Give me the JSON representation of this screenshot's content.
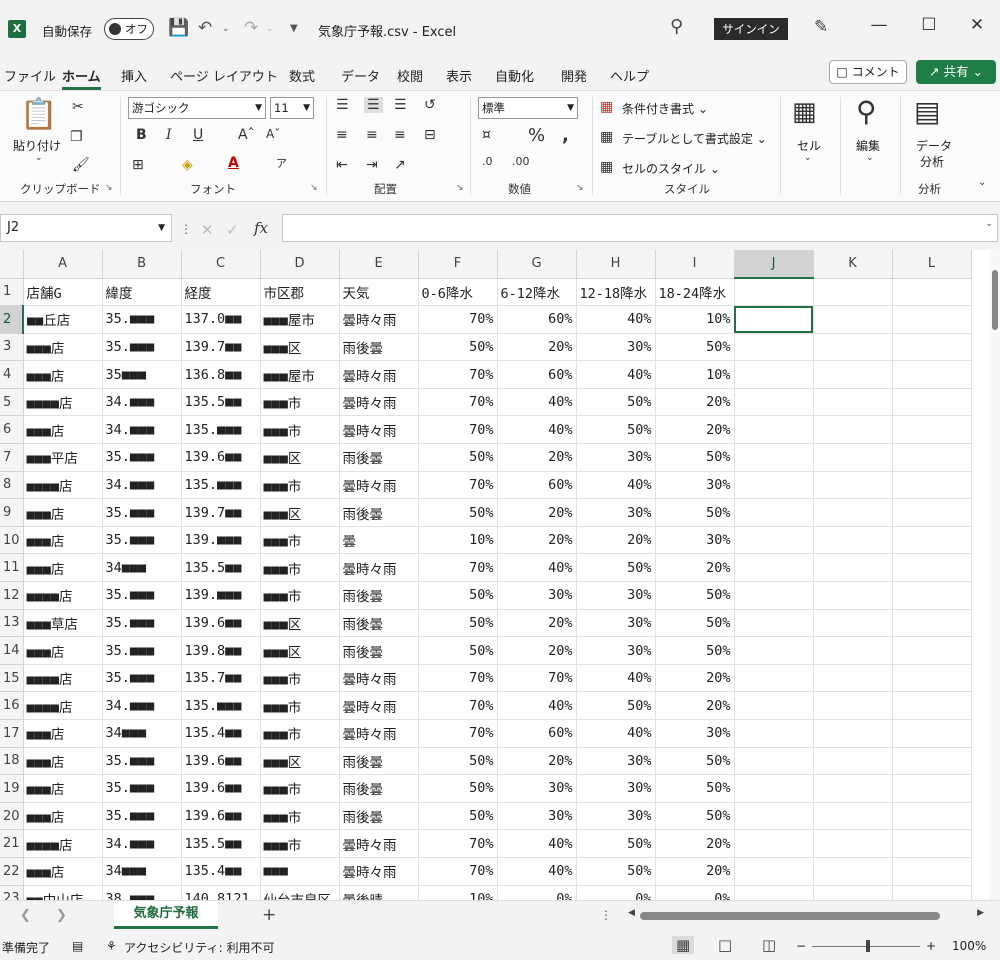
{
  "titlebar": {
    "logo": "X",
    "autosave_label": "自動保存",
    "toggle_label": "オフ",
    "doc_title": "気象庁予報.csv  -  Excel",
    "signin_label": "サインイン"
  },
  "menu": {
    "tabs": [
      "ファイル",
      "ホーム",
      "挿入",
      "ページ レイアウト",
      "数式",
      "データ",
      "校閲",
      "表示",
      "自動化",
      "開発",
      "ヘルプ"
    ],
    "active_tab": "ホーム",
    "comment_label": "コメント",
    "share_label": "共有"
  },
  "ribbon": {
    "clipboard": {
      "paste_label": "貼り付け",
      "group_label": "クリップボード"
    },
    "font": {
      "font_name": "游ゴシック",
      "font_size": "11",
      "group_label": "フォント"
    },
    "alignment": {
      "group_label": "配置"
    },
    "number": {
      "format": "標準",
      "group_label": "数値"
    },
    "styles": {
      "conditional_label": "条件付き書式",
      "table_label": "テーブルとして書式設定",
      "cell_style_label": "セルのスタイル",
      "group_label": "スタイル"
    },
    "cells": {
      "label": "セル"
    },
    "editing": {
      "label": "編集"
    },
    "analysis": {
      "button_label_1": "データ",
      "button_label_2": "分析",
      "group_label": "分析"
    }
  },
  "formula_bar": {
    "name_box": "J2",
    "fx": "fx",
    "value": ""
  },
  "grid": {
    "columns": [
      "A",
      "B",
      "C",
      "D",
      "E",
      "F",
      "G",
      "H",
      "I",
      "J",
      "K",
      "L"
    ],
    "selected_cell": "J2",
    "rows": [
      [
        "店舗G",
        "緯度",
        "経度",
        "市区郡",
        "天気",
        "0-6降水",
        "6-12降水",
        "12-18降水",
        "18-24降水"
      ],
      [
        "■■丘店",
        "35.■■■",
        "137.0■■",
        "■■■屋市",
        "曇時々雨",
        "70%",
        "60%",
        "40%",
        "10%"
      ],
      [
        "■■■店",
        "35.■■■",
        "139.7■■",
        "■■■区",
        "雨後曇",
        "50%",
        "20%",
        "30%",
        "50%"
      ],
      [
        "■■■店",
        "35■■■",
        "136.8■■",
        "■■■屋市",
        "曇時々雨",
        "70%",
        "60%",
        "40%",
        "10%"
      ],
      [
        "■■■■店",
        "34.■■■",
        "135.5■■",
        "■■■市",
        "曇時々雨",
        "70%",
        "40%",
        "50%",
        "20%"
      ],
      [
        "■■■店",
        "34.■■■",
        "135.■■■",
        "■■■市",
        "曇時々雨",
        "70%",
        "40%",
        "50%",
        "20%"
      ],
      [
        "■■■平店",
        "35.■■■",
        "139.6■■",
        "■■■区",
        "雨後曇",
        "50%",
        "20%",
        "30%",
        "50%"
      ],
      [
        "■■■■店",
        "34.■■■",
        "135.■■■",
        "■■■市",
        "曇時々雨",
        "70%",
        "60%",
        "40%",
        "30%"
      ],
      [
        "■■■店",
        "35.■■■",
        "139.7■■",
        "■■■区",
        "雨後曇",
        "50%",
        "20%",
        "30%",
        "50%"
      ],
      [
        "■■■店",
        "35.■■■",
        "139.■■■",
        "■■■市",
        "曇",
        "10%",
        "20%",
        "20%",
        "30%"
      ],
      [
        "■■■店",
        "34■■■",
        "135.5■■",
        "■■■市",
        "曇時々雨",
        "70%",
        "40%",
        "50%",
        "20%"
      ],
      [
        "■■■■店",
        "35.■■■",
        "139.■■■",
        "■■■市",
        "雨後曇",
        "50%",
        "30%",
        "30%",
        "50%"
      ],
      [
        "■■■草店",
        "35.■■■",
        "139.6■■",
        "■■■区",
        "雨後曇",
        "50%",
        "20%",
        "30%",
        "50%"
      ],
      [
        "■■■店",
        "35.■■■",
        "139.8■■",
        "■■■区",
        "雨後曇",
        "50%",
        "20%",
        "30%",
        "50%"
      ],
      [
        "■■■■店",
        "35.■■■",
        "135.7■■",
        "■■■市",
        "曇時々雨",
        "70%",
        "70%",
        "40%",
        "20%"
      ],
      [
        "■■■■店",
        "34.■■■",
        "135.■■■",
        "■■■市",
        "曇時々雨",
        "70%",
        "40%",
        "50%",
        "20%"
      ],
      [
        "■■■店",
        "34■■■",
        "135.4■■",
        "■■■市",
        "曇時々雨",
        "70%",
        "60%",
        "40%",
        "30%"
      ],
      [
        "■■■店",
        "35.■■■",
        "139.6■■",
        "■■■区",
        "雨後曇",
        "50%",
        "20%",
        "30%",
        "50%"
      ],
      [
        "■■■店",
        "35.■■■",
        "139.6■■",
        "■■■市",
        "雨後曇",
        "50%",
        "30%",
        "30%",
        "50%"
      ],
      [
        "■■■店",
        "35.■■■",
        "139.6■■",
        "■■■市",
        "雨後曇",
        "50%",
        "30%",
        "30%",
        "50%"
      ],
      [
        "■■■■店",
        "34.■■■",
        "135.5■■",
        "■■■市",
        "曇時々雨",
        "70%",
        "40%",
        "50%",
        "20%"
      ],
      [
        "■■■店",
        "34■■■",
        "135.4■■",
        "■■■",
        "曇時々雨",
        "70%",
        "40%",
        "50%",
        "20%"
      ],
      [
        "■■中山店",
        "38.■■■",
        "140.8121",
        "仙台市泉区",
        "曇後晴",
        "10%",
        "0%",
        "0%",
        "0%"
      ]
    ]
  },
  "sheet_tabs": {
    "tabs": [
      "気象庁予報"
    ],
    "active": "気象庁予報"
  },
  "statusbar": {
    "ready": "準備完了",
    "accessibility": "アクセシビリティ: 利用不可",
    "zoom": "100%",
    "zoom_minus": "−",
    "zoom_plus": "+"
  }
}
